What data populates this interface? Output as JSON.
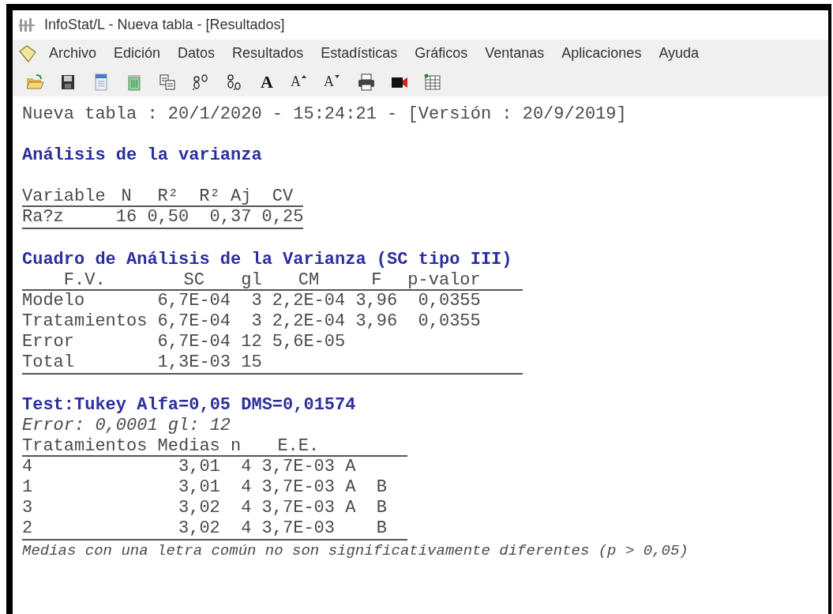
{
  "window": {
    "title": "InfoStat/L - Nueva tabla - [Resultados]"
  },
  "menu": [
    "Archivo",
    "Edición",
    "Datos",
    "Resultados",
    "Estadísticas",
    "Gráficos",
    "Ventanas",
    "Aplicaciones",
    "Ayuda"
  ],
  "toolbar": [
    {
      "kind": "icon"
    },
    {
      "kind": "icon"
    },
    {
      "kind": "icon"
    },
    {
      "kind": "icon"
    },
    {
      "kind": "icon"
    },
    {
      "kind": "icon"
    },
    {
      "kind": "icon"
    },
    {
      "kind": "glyph",
      "label": "A"
    },
    {
      "kind": "grow",
      "label": "A"
    },
    {
      "kind": "shrink",
      "label": "A"
    },
    {
      "kind": "icon"
    },
    {
      "kind": "icon"
    },
    {
      "kind": "icon"
    }
  ],
  "output": {
    "header": "Nueva tabla : 20/1/2020 - 15:24:21 - [Versión : 20/9/2019]",
    "anova_title": "Análisis de la varianza",
    "summary_table": {
      "columns": [
        "Variable",
        "N",
        "R²",
        "R² Aj",
        "CV"
      ],
      "rows": [
        [
          "Ra?z",
          "16",
          "0,50",
          "0,37",
          "0,25"
        ]
      ]
    },
    "anova_table_title": "Cuadro de Análisis de la Varianza (SC tipo III)",
    "anova_table": {
      "columns": [
        "F.V.",
        "SC",
        "gl",
        "CM",
        "F",
        "p-valor"
      ],
      "rows": [
        [
          "Modelo",
          "6,7E-04",
          "3",
          "2,2E-04",
          "3,96",
          "0,0355"
        ],
        [
          "Tratamientos",
          "6,7E-04",
          "3",
          "2,2E-04",
          "3,96",
          "0,0355"
        ],
        [
          "Error",
          "6,7E-04",
          "12",
          "5,6E-05"
        ],
        [
          "Total",
          "1,3E-03",
          "15"
        ]
      ]
    },
    "tukey_title": "Test:Tukey Alfa=0,05 DMS=0,01574",
    "tukey_error": "Error: 0,0001 gl: 12",
    "tukey_table": {
      "columns": [
        "Tratamientos",
        "Medias",
        "n",
        "E.E."
      ],
      "rows": [
        {
          "cells": [
            "4",
            "3,01",
            "4",
            "3,7E-03"
          ],
          "letters": [
            {
              "letter": "A",
              "kind": "first"
            }
          ]
        },
        {
          "cells": [
            "1",
            "3,01",
            "4",
            "3,7E-03"
          ],
          "letters": [
            {
              "letter": "A",
              "kind": "first"
            },
            {
              "letter": "B",
              "kind": "second"
            }
          ]
        },
        {
          "cells": [
            "3",
            "3,02",
            "4",
            "3,7E-03"
          ],
          "letters": [
            {
              "letter": "A",
              "kind": "first"
            },
            {
              "letter": "B",
              "kind": "second"
            }
          ]
        },
        {
          "cells": [
            "2",
            "3,02",
            "4",
            "3,7E-03"
          ],
          "letters": [
            {
              "letter": "B",
              "kind": "second"
            }
          ]
        }
      ]
    },
    "tukey_note": "Medias con una letra común no son significativamente diferentes (p > 0,05)"
  }
}
